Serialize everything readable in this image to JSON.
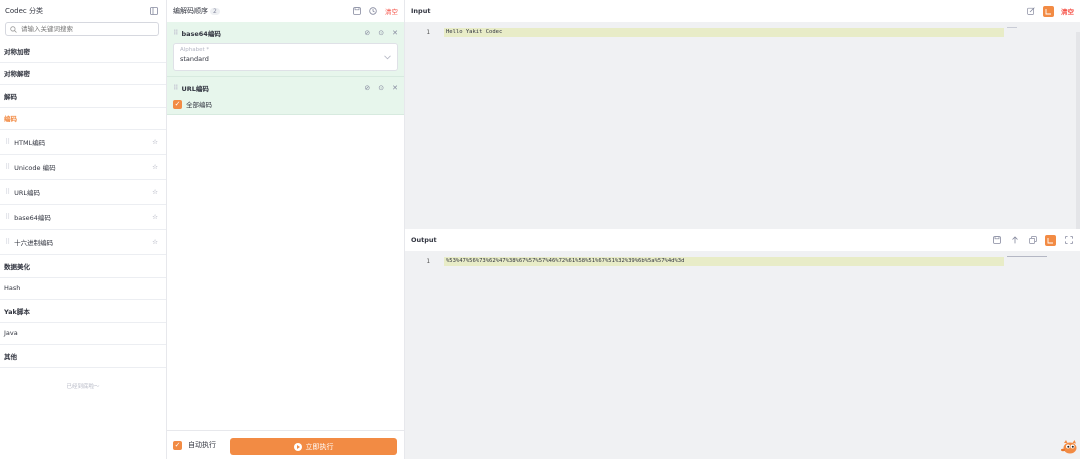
{
  "left": {
    "title": "Codec 分类",
    "search_placeholder": "请输入关键词搜索",
    "categories": [
      {
        "label": "对称加密"
      },
      {
        "label": "对称解密"
      },
      {
        "label": "解码"
      },
      {
        "label": "编码"
      }
    ],
    "sub_items": [
      {
        "label": "HTML编码"
      },
      {
        "label": "Unicode 编码"
      },
      {
        "label": "URL编码"
      },
      {
        "label": "base64编码"
      },
      {
        "label": "十六进制编码"
      }
    ],
    "categories2": [
      {
        "label": "数据美化"
      },
      {
        "label": "Hash"
      },
      {
        "label": "Yak脚本"
      },
      {
        "label": "Java"
      },
      {
        "label": "其他"
      }
    ],
    "footer": "已经到底啦～"
  },
  "mid": {
    "title": "编解码顺序",
    "count": "2",
    "clear": "清空",
    "steps": [
      {
        "name": "base64编码",
        "field_label": "Alphabet *",
        "field_value": "standard"
      },
      {
        "name": "URL编码",
        "checkbox_label": "全部编码"
      }
    ],
    "auto_label": "自动执行",
    "run_label": "立即执行"
  },
  "right": {
    "input_title": "Input",
    "clear": "清空",
    "input_line_no": "1",
    "input_text": "Hello Yakit Codec",
    "output_title": "Output",
    "output_line_no": "1",
    "output_text": "%53%47%56%73%62%47%38%67%57%57%46%72%61%58%51%67%51%32%39%6b%5a%57%4d%3d"
  },
  "colors": {
    "accent": "#f28b44",
    "step_bg": "#e7f6ec",
    "editor_bg": "#f0f1f3",
    "line_highlight": "#e8ecc7",
    "danger": "#f6544a"
  }
}
